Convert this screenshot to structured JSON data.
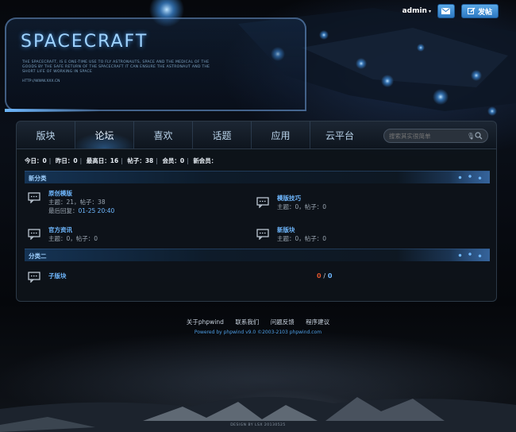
{
  "header": {
    "logo_text": "SPACECRAFT",
    "tagline": "THE SPACECRAFT, IS E ONE-TIME USE TO FLY ASTRONAUTS, SPACE AND THE MEDICAL OF THE GOODS BY THE SAFE RETURN OF THE SPACECRAFT IT CAN ENSURE THE ASTRONAUT AND THE SHORT LIFE OF WORKING IN SPACE",
    "url": "HTTP://WWW.XXX.CN"
  },
  "userbar": {
    "username": "admin",
    "post_label": "发帖"
  },
  "nav": {
    "items": [
      "版块",
      "论坛",
      "喜欢",
      "话题",
      "应用",
      "云平台"
    ],
    "active_index": 1,
    "search_placeholder": "搜索其实很简单"
  },
  "stats": {
    "today": "今日：0",
    "yesterday": "昨日：0",
    "max": "最高日：16",
    "posts": "帖子：38",
    "members": "会员：0",
    "new_member": "新会员："
  },
  "categories": [
    {
      "title": "新分类",
      "forums": [
        {
          "name": "原创模版",
          "meta": "主题：21，帖子：38",
          "last_label": "最后回复：",
          "last_value": "01-25 20:40"
        },
        {
          "name": "模版技巧",
          "meta": "主题：0，帖子：0"
        },
        {
          "name": "官方资讯",
          "meta": "主题：0，帖子：0"
        },
        {
          "name": "新版块",
          "meta": "主题：0，帖子：0"
        }
      ]
    },
    {
      "title": "分类二",
      "forums": [
        {
          "name": "子版块",
          "stat_a": "0",
          "stat_sep": "/",
          "stat_b": "0"
        }
      ]
    }
  ],
  "footer": {
    "links": [
      "关于phpwind",
      "联系我们",
      "问题反馈",
      "程序建议"
    ],
    "powered": "Powered by phpwind v9.0 ©2003-2103 phpwind.com",
    "design": "DESIGN BY LSX 20130525"
  },
  "colors": {
    "accent": "#6fb8ff",
    "button": "#2d79c2",
    "highlight": "#e0542c"
  }
}
